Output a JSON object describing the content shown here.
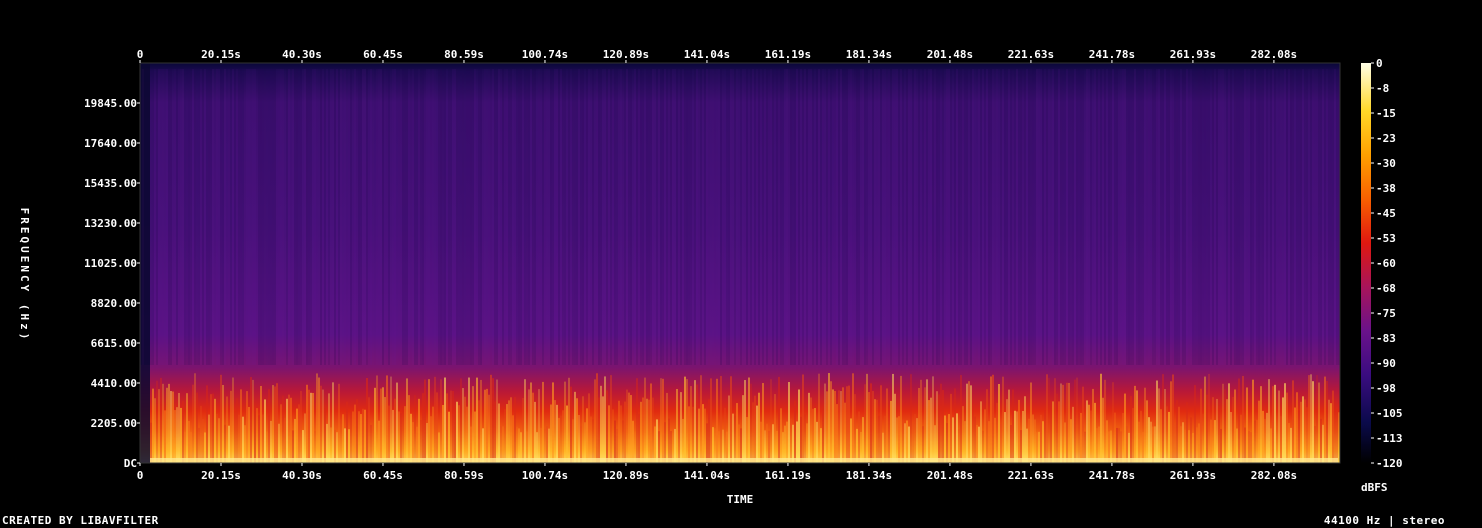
{
  "chart_data": {
    "type": "heatmap",
    "title": "",
    "xlabel": "TIME",
    "ylabel": "FREQUENCY (Hz)",
    "x_ticks": [
      "0",
      "20.15s",
      "40.30s",
      "60.45s",
      "80.59s",
      "100.74s",
      "120.89s",
      "141.04s",
      "161.19s",
      "181.34s",
      "201.48s",
      "221.63s",
      "241.78s",
      "261.93s",
      "282.08s"
    ],
    "y_ticks": [
      "DC",
      "2205.00",
      "4410.00",
      "6615.00",
      "8820.00",
      "11025.00",
      "13230.00",
      "15435.00",
      "17640.00",
      "19845.00"
    ],
    "y_tick_values": [
      0,
      2205,
      4410,
      6615,
      8820,
      11025,
      13230,
      15435,
      17640,
      19845
    ],
    "xlim": [
      0,
      298.5
    ],
    "ylim": [
      0,
      22050
    ],
    "colorbar": {
      "label": "dBFS",
      "ticks": [
        "0",
        "-8",
        "-15",
        "-23",
        "-30",
        "-38",
        "-45",
        "-53",
        "-60",
        "-68",
        "-75",
        "-83",
        "-90",
        "-98",
        "-105",
        "-113",
        "-120"
      ],
      "range": [
        -120,
        0
      ]
    },
    "colormap": [
      "#000000",
      "#0a0a3a",
      "#2a0a6e",
      "#4a108a",
      "#6a128a",
      "#a0145c",
      "#d81818",
      "#f03c00",
      "#ff7800",
      "#ffb400",
      "#ffe040",
      "#ffffd8"
    ],
    "description_levels_db": {
      "low_band_0_2kHz": -40,
      "mid_band_2_4kHz": -55,
      "band_4_6kHz": -65,
      "high_band_above_8kHz": -88
    }
  },
  "footer": {
    "left": "CREATED BY LIBAVFILTER",
    "right": "44100 Hz | stereo"
  }
}
